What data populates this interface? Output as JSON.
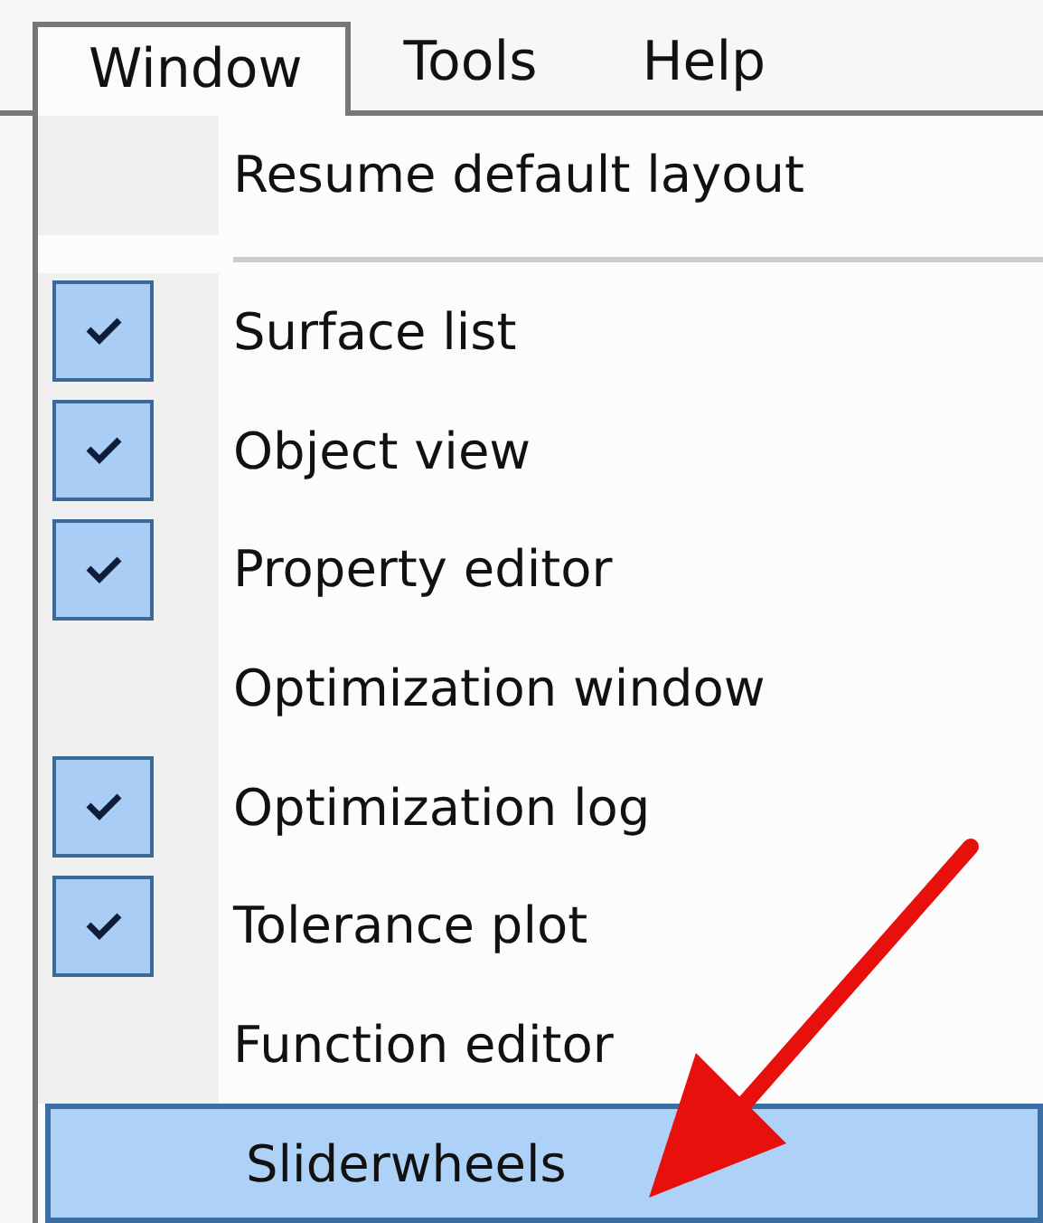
{
  "menu_bar": [
    {
      "label": "Window",
      "selected": true
    },
    {
      "label": "Tools",
      "selected": false
    },
    {
      "label": "Help",
      "selected": false
    }
  ],
  "menu": [
    {
      "kind": "item",
      "label": "Resume default layout",
      "checked": false,
      "selected": false
    },
    {
      "kind": "separator"
    },
    {
      "kind": "item",
      "label": "Surface list",
      "checked": true,
      "selected": false
    },
    {
      "kind": "item",
      "label": "Object view",
      "checked": true,
      "selected": false
    },
    {
      "kind": "item",
      "label": "Property editor",
      "checked": true,
      "selected": false
    },
    {
      "kind": "item",
      "label": "Optimization window",
      "checked": false,
      "selected": false
    },
    {
      "kind": "item",
      "label": "Optimization log",
      "checked": true,
      "selected": false
    },
    {
      "kind": "item",
      "label": "Tolerance plot",
      "checked": true,
      "selected": false
    },
    {
      "kind": "item",
      "label": "Function editor",
      "checked": false,
      "selected": false
    },
    {
      "kind": "item",
      "label": "Sliderwheels",
      "checked": false,
      "selected": true
    }
  ]
}
